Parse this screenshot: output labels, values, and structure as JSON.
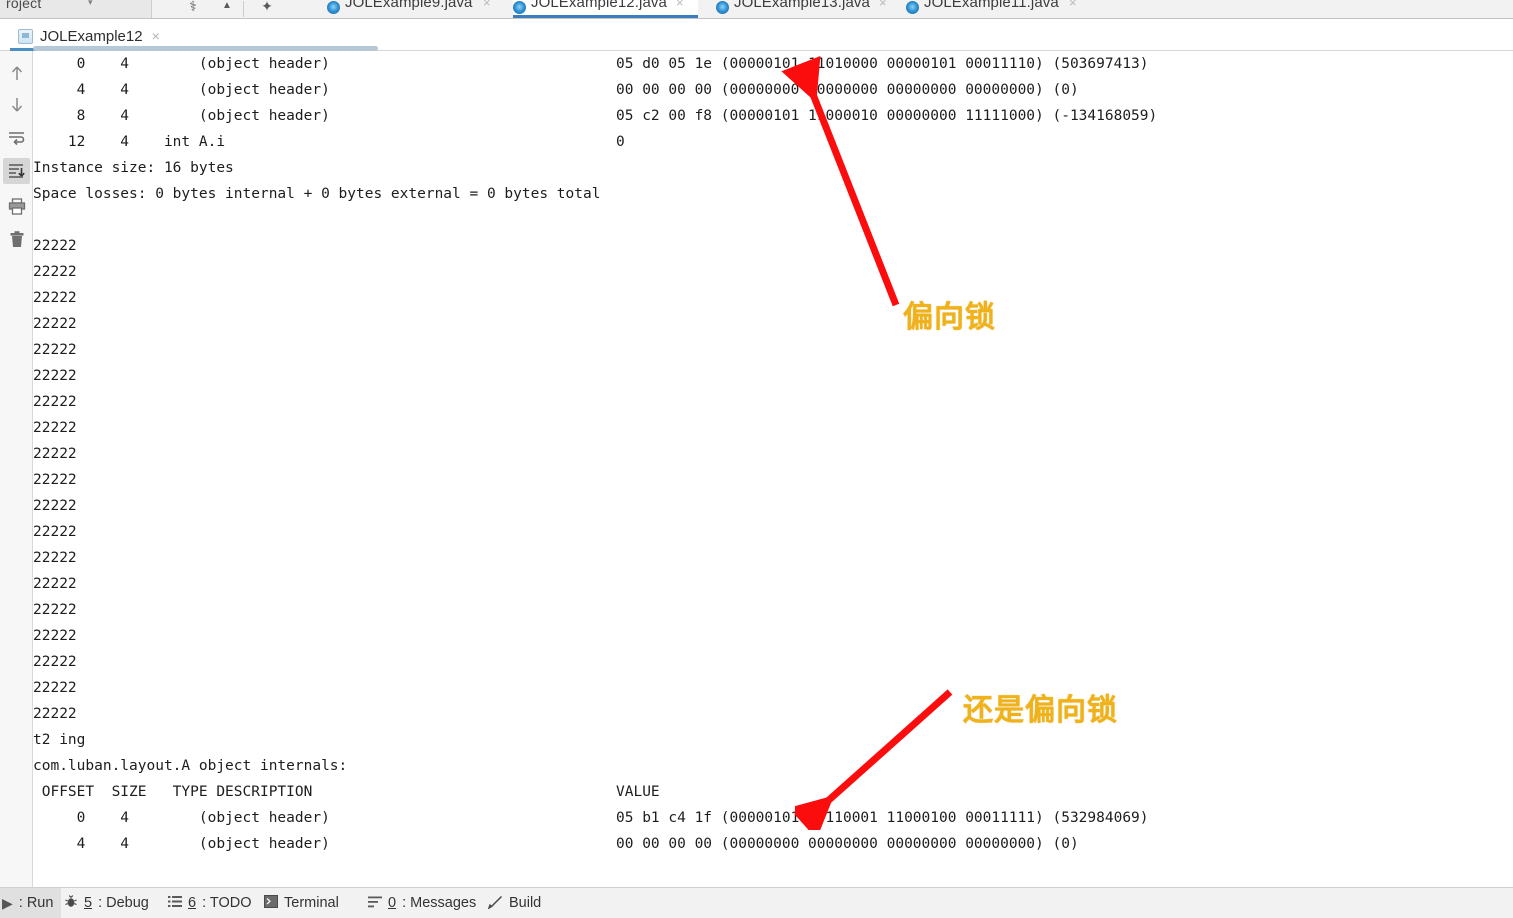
{
  "window": {
    "project_tool_label": "roject",
    "run_tab_title": "JOLExample12",
    "close_glyph": "×"
  },
  "toolbar": {
    "icons": [
      {
        "name": "anchor-icon",
        "glyph": "⚕"
      },
      {
        "name": "collapse-up-icon",
        "glyph": "▲"
      },
      {
        "name": "pin-icon",
        "glyph": "✦"
      }
    ]
  },
  "editor_tabs": [
    {
      "label": "JOLExample9.java",
      "selected": false
    },
    {
      "label": "JOLExample12.java",
      "selected": true
    },
    {
      "label": "JOLExample13.java",
      "selected": false
    },
    {
      "label": "JOLExample11.java",
      "selected": false
    }
  ],
  "gutter_buttons": [
    {
      "name": "scroll-up-button",
      "icon": "arrow-up-icon",
      "active": false
    },
    {
      "name": "scroll-down-button",
      "icon": "arrow-down-icon",
      "active": false
    },
    {
      "name": "soft-wrap-button",
      "icon": "soft-wrap-icon",
      "active": false
    },
    {
      "name": "scroll-to-end-button",
      "icon": "scroll-to-end-icon",
      "active": true
    },
    {
      "name": "print-button",
      "icon": "printer-icon",
      "active": false
    },
    {
      "name": "clear-all-button",
      "icon": "trash-icon",
      "active": false
    }
  ],
  "console": {
    "lines": [
      {
        "text": "     0    4        (object header)",
        "value": "05 d0 05 1e (00000101 11010000 00000101 00011110) (503697413)"
      },
      {
        "text": "     4    4        (object header)",
        "value": "00 00 00 00 (00000000 00000000 00000000 00000000) (0)"
      },
      {
        "text": "     8    4        (object header)",
        "value": "05 c2 00 f8 (00000101 11000010 00000000 11111000) (-134168059)"
      },
      {
        "text": "    12    4    int A.i",
        "value": "0"
      },
      {
        "text": "Instance size: 16 bytes",
        "value": ""
      },
      {
        "text": "Space losses: 0 bytes internal + 0 bytes external = 0 bytes total",
        "value": ""
      },
      {
        "text": "",
        "value": ""
      },
      {
        "text": "22222",
        "value": ""
      },
      {
        "text": "22222",
        "value": ""
      },
      {
        "text": "22222",
        "value": ""
      },
      {
        "text": "22222",
        "value": ""
      },
      {
        "text": "22222",
        "value": ""
      },
      {
        "text": "22222",
        "value": ""
      },
      {
        "text": "22222",
        "value": ""
      },
      {
        "text": "22222",
        "value": ""
      },
      {
        "text": "22222",
        "value": ""
      },
      {
        "text": "22222",
        "value": ""
      },
      {
        "text": "22222",
        "value": ""
      },
      {
        "text": "22222",
        "value": ""
      },
      {
        "text": "22222",
        "value": ""
      },
      {
        "text": "22222",
        "value": ""
      },
      {
        "text": "22222",
        "value": ""
      },
      {
        "text": "22222",
        "value": ""
      },
      {
        "text": "22222",
        "value": ""
      },
      {
        "text": "22222",
        "value": ""
      },
      {
        "text": "22222",
        "value": ""
      },
      {
        "text": "t2 ing",
        "value": ""
      },
      {
        "text": "com.luban.layout.A object internals:",
        "value": ""
      },
      {
        "text": " OFFSET  SIZE   TYPE DESCRIPTION",
        "value": "VALUE"
      },
      {
        "text": "     0    4        (object header)",
        "value": "05 b1 c4 1f (00000101 10110001 11000100 00011111) (532984069)"
      },
      {
        "text": "     4    4        (object header)",
        "value": "00 00 00 00 (00000000 00000000 00000000 00000000) (0)"
      }
    ]
  },
  "annotations": [
    {
      "text": "偏向锁",
      "color": "#f0b21c"
    },
    {
      "text": "还是偏向锁",
      "color": "#f0b21c"
    }
  ],
  "arrow_color": "#fc0d0d",
  "statusbar": {
    "items": [
      {
        "label": ": Run",
        "mnemonic": "",
        "icon": "run-icon",
        "selected": true
      },
      {
        "label": ": Debug",
        "mnemonic": "5",
        "icon": "debug-bug-icon",
        "selected": false
      },
      {
        "label": ": TODO",
        "mnemonic": "6",
        "icon": "todo-list-icon",
        "selected": false
      },
      {
        "label": "Terminal",
        "mnemonic": "",
        "icon": "terminal-icon",
        "selected": false
      },
      {
        "label": ": Messages",
        "mnemonic": "0",
        "icon": "messages-icon",
        "selected": false
      },
      {
        "label": "Build",
        "mnemonic": "",
        "icon": "build-hammer-icon",
        "selected": false
      }
    ]
  }
}
